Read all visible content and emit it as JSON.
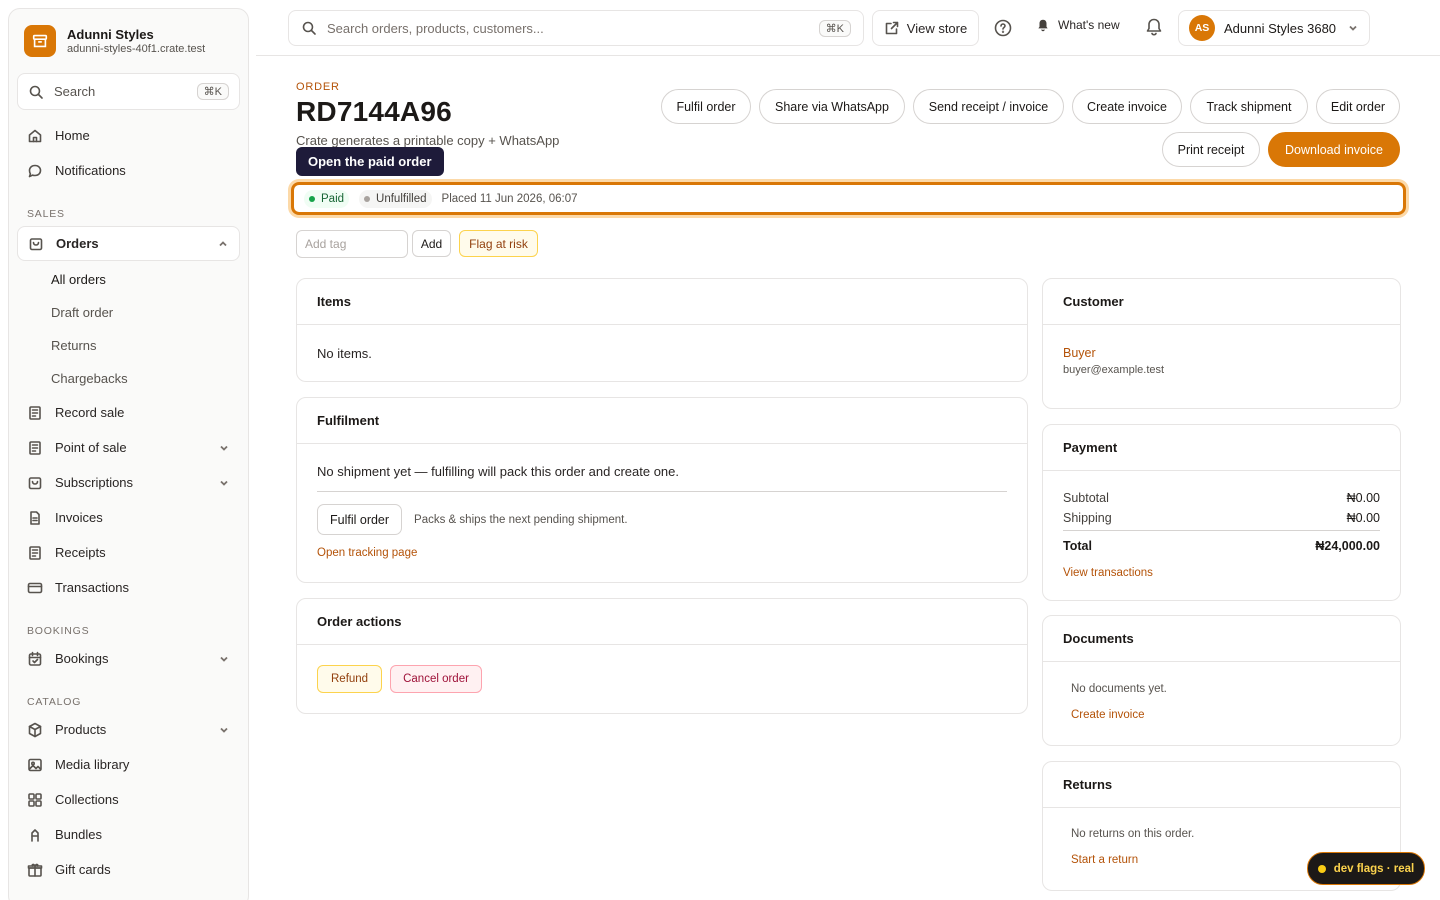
{
  "brand": {
    "name": "Adunni Styles",
    "domain": "adunni-styles-40f1.crate.test"
  },
  "sidebar": {
    "search_label": "Search",
    "search_kbd": "⌘K",
    "items_top": [
      {
        "label": "Home",
        "icon": "home-icon"
      },
      {
        "label": "Notifications",
        "icon": "chat-icon"
      }
    ],
    "section_sales": "SALES",
    "orders_label": "Orders",
    "orders_sub": [
      "All orders",
      "Draft order",
      "Returns",
      "Chargebacks"
    ],
    "sales_items": [
      {
        "label": "Record sale",
        "icon": "receipt-icon",
        "has_chevron": false
      },
      {
        "label": "Point of sale",
        "icon": "receipt-icon",
        "has_chevron": true
      },
      {
        "label": "Subscriptions",
        "icon": "bag-icon",
        "has_chevron": true
      },
      {
        "label": "Invoices",
        "icon": "document-icon",
        "has_chevron": false
      },
      {
        "label": "Receipts",
        "icon": "receipt-icon",
        "has_chevron": false
      },
      {
        "label": "Transactions",
        "icon": "card-icon",
        "has_chevron": false
      }
    ],
    "section_bookings": "BOOKINGS",
    "bookings_label": "Bookings",
    "section_catalog": "CATALOG",
    "catalog_items": [
      {
        "label": "Products",
        "icon": "box-icon",
        "has_chevron": true
      },
      {
        "label": "Media library",
        "icon": "image-icon",
        "has_chevron": false
      },
      {
        "label": "Collections",
        "icon": "grid-icon",
        "has_chevron": false
      },
      {
        "label": "Bundles",
        "icon": "bundle-icon",
        "has_chevron": false
      },
      {
        "label": "Gift cards",
        "icon": "gift-icon",
        "has_chevron": false
      }
    ]
  },
  "topbar": {
    "search_placeholder": "Search orders, products, customers...",
    "search_kbd": "⌘K",
    "view_store": "View store",
    "whats_new": "What's new",
    "account_initials": "AS",
    "account_name": "Adunni Styles 3680"
  },
  "order": {
    "eyebrow": "ORDER",
    "id": "RD7144A96",
    "subtitle": "Crate generates a printable copy + WhatsApp",
    "actions": [
      "Fulfil order",
      "Share via WhatsApp",
      "Send receipt / invoice",
      "Create invoice",
      "Track shipment",
      "Edit order"
    ],
    "print_receipt": "Print receipt",
    "download_invoice": "Download invoice",
    "tooltip": "Open the paid order",
    "status_paid": "Paid",
    "status_fulfilment": "Unfulfilled",
    "placed": "Placed 11 Jun 2026, 06:07",
    "tag_placeholder": "Add tag",
    "add_label": "Add",
    "flag_label": "Flag at risk"
  },
  "items_card": {
    "title": "Items",
    "empty": "No items."
  },
  "fulfilment_card": {
    "title": "Fulfilment",
    "message": "No shipment yet — fulfilling will pack this order and create one.",
    "button": "Fulfil order",
    "hint": "Packs & ships the next pending shipment.",
    "link": "Open tracking page"
  },
  "order_actions_card": {
    "title": "Order actions",
    "refund": "Refund",
    "cancel": "Cancel order"
  },
  "customer_card": {
    "title": "Customer",
    "name": "Buyer",
    "email": "buyer@example.test"
  },
  "payment_card": {
    "title": "Payment",
    "subtotal_label": "Subtotal",
    "subtotal": "₦0.00",
    "shipping_label": "Shipping",
    "shipping": "₦0.00",
    "total_label": "Total",
    "total": "₦24,000.00",
    "link": "View transactions"
  },
  "documents_card": {
    "title": "Documents",
    "empty": "No documents yet.",
    "link": "Create invoice"
  },
  "returns_card": {
    "title": "Returns",
    "empty": "No returns on this order.",
    "link": "Start a return"
  },
  "dev_flags": "dev flags · real",
  "colors": {
    "accent": "#d97706",
    "paid": "#16a34a",
    "tooltip_bg": "#1e1b3a"
  }
}
